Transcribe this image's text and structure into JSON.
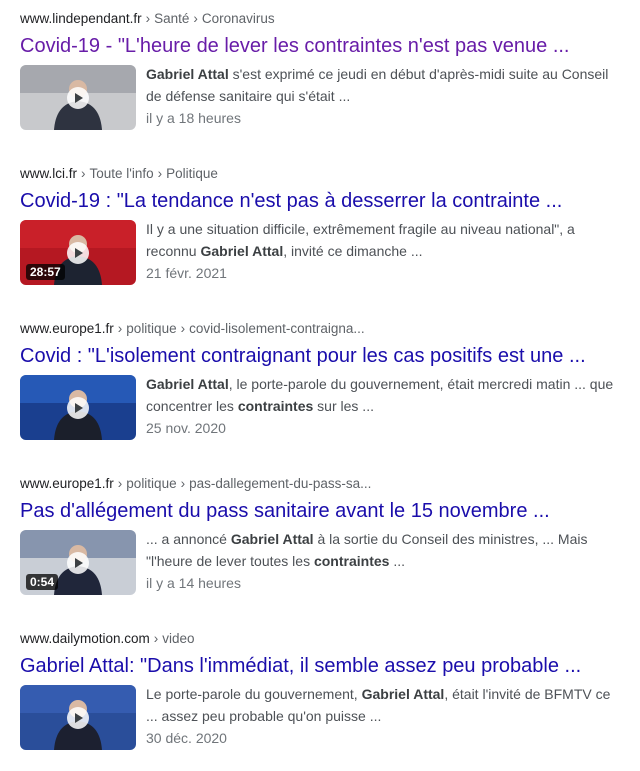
{
  "results": [
    {
      "domain": "www.lindependant.fr",
      "crumbs": [
        "Santé",
        "Coronavirus"
      ],
      "title": "Covid-19 - \"L'heure de lever les contraintes n'est pas venue ...",
      "title_state": "visited",
      "snippet_line1": [
        [
          "Gabriel Attal",
          true
        ],
        [
          " s'est exprimé ce jeudi en début d'après-midi suite au Conseil",
          false
        ]
      ],
      "snippet_line2": [
        [
          "de défense sanitaire qui s'était ...",
          false
        ]
      ],
      "date": "il y a 18 heures",
      "duration": "",
      "thumb_colors": [
        "#c8c9cc",
        "#8f9399",
        "#2e3340"
      ]
    },
    {
      "domain": "www.lci.fr",
      "crumbs": [
        "Toute l'info",
        "Politique"
      ],
      "title": "Covid-19 : \"La tendance n'est pas à desserrer la contrainte ...",
      "title_state": "unvisited",
      "snippet_line1": [
        [
          "Il y a une situation difficile, extrêmement fragile au niveau national\", a",
          false
        ]
      ],
      "snippet_line2": [
        [
          "reconnu ",
          false
        ],
        [
          "Gabriel Attal",
          true
        ],
        [
          ", invité ce dimanche ...",
          false
        ]
      ],
      "date": "21 févr. 2021",
      "duration": "28:57",
      "thumb_colors": [
        "#b51822",
        "#d7262f",
        "#1d2331"
      ]
    },
    {
      "domain": "www.europe1.fr",
      "crumbs": [
        "politique",
        "covid-lisolement-contraigna..."
      ],
      "title": "Covid : \"L'isolement contraignant pour les cas positifs est une ...",
      "title_state": "unvisited",
      "snippet_line1": [
        [
          "Gabriel Attal",
          true
        ],
        [
          ", le porte-parole du gouvernement, était mercredi matin ... que",
          false
        ]
      ],
      "snippet_line2": [
        [
          "concentrer les ",
          false
        ],
        [
          "contraintes",
          true
        ],
        [
          " sur les ...",
          false
        ]
      ],
      "date": "25 nov. 2020",
      "duration": "",
      "thumb_colors": [
        "#1a3f8f",
        "#2f6ad1",
        "#1b1f2b"
      ]
    },
    {
      "domain": "www.europe1.fr",
      "crumbs": [
        "politique",
        "pas-dallegement-du-pass-sa..."
      ],
      "title": "Pas d'allégement du pass sanitaire avant le 15 novembre ...",
      "title_state": "unvisited",
      "snippet_line1": [
        [
          "... a annoncé ",
          false
        ],
        [
          "Gabriel Attal",
          true
        ],
        [
          " à la sortie du Conseil des ministres, ... Mais",
          false
        ]
      ],
      "snippet_line2": [
        [
          "\"l'heure de lever toutes les ",
          false
        ],
        [
          "contraintes",
          true
        ],
        [
          " ...",
          false
        ]
      ],
      "date": "il y a 14 heures",
      "duration": "0:54",
      "thumb_colors": [
        "#c9ced6",
        "#5b6f92",
        "#20263a"
      ]
    },
    {
      "domain": "www.dailymotion.com",
      "crumbs": [
        "video"
      ],
      "title": "Gabriel Attal: \"Dans l'immédiat, il semble assez peu probable ...",
      "title_state": "unvisited",
      "snippet_line1": [
        [
          "Le porte-parole du gouvernement, ",
          false
        ],
        [
          "Gabriel Attal",
          true
        ],
        [
          ", était l'invité de BFMTV ce",
          false
        ]
      ],
      "snippet_line2": [
        [
          "... assez peu probable qu'on puisse ...",
          false
        ]
      ],
      "date": "30 déc. 2020",
      "duration": "",
      "thumb_colors": [
        "#2a4e9a",
        "#3d66c0",
        "#1c2030"
      ]
    }
  ]
}
